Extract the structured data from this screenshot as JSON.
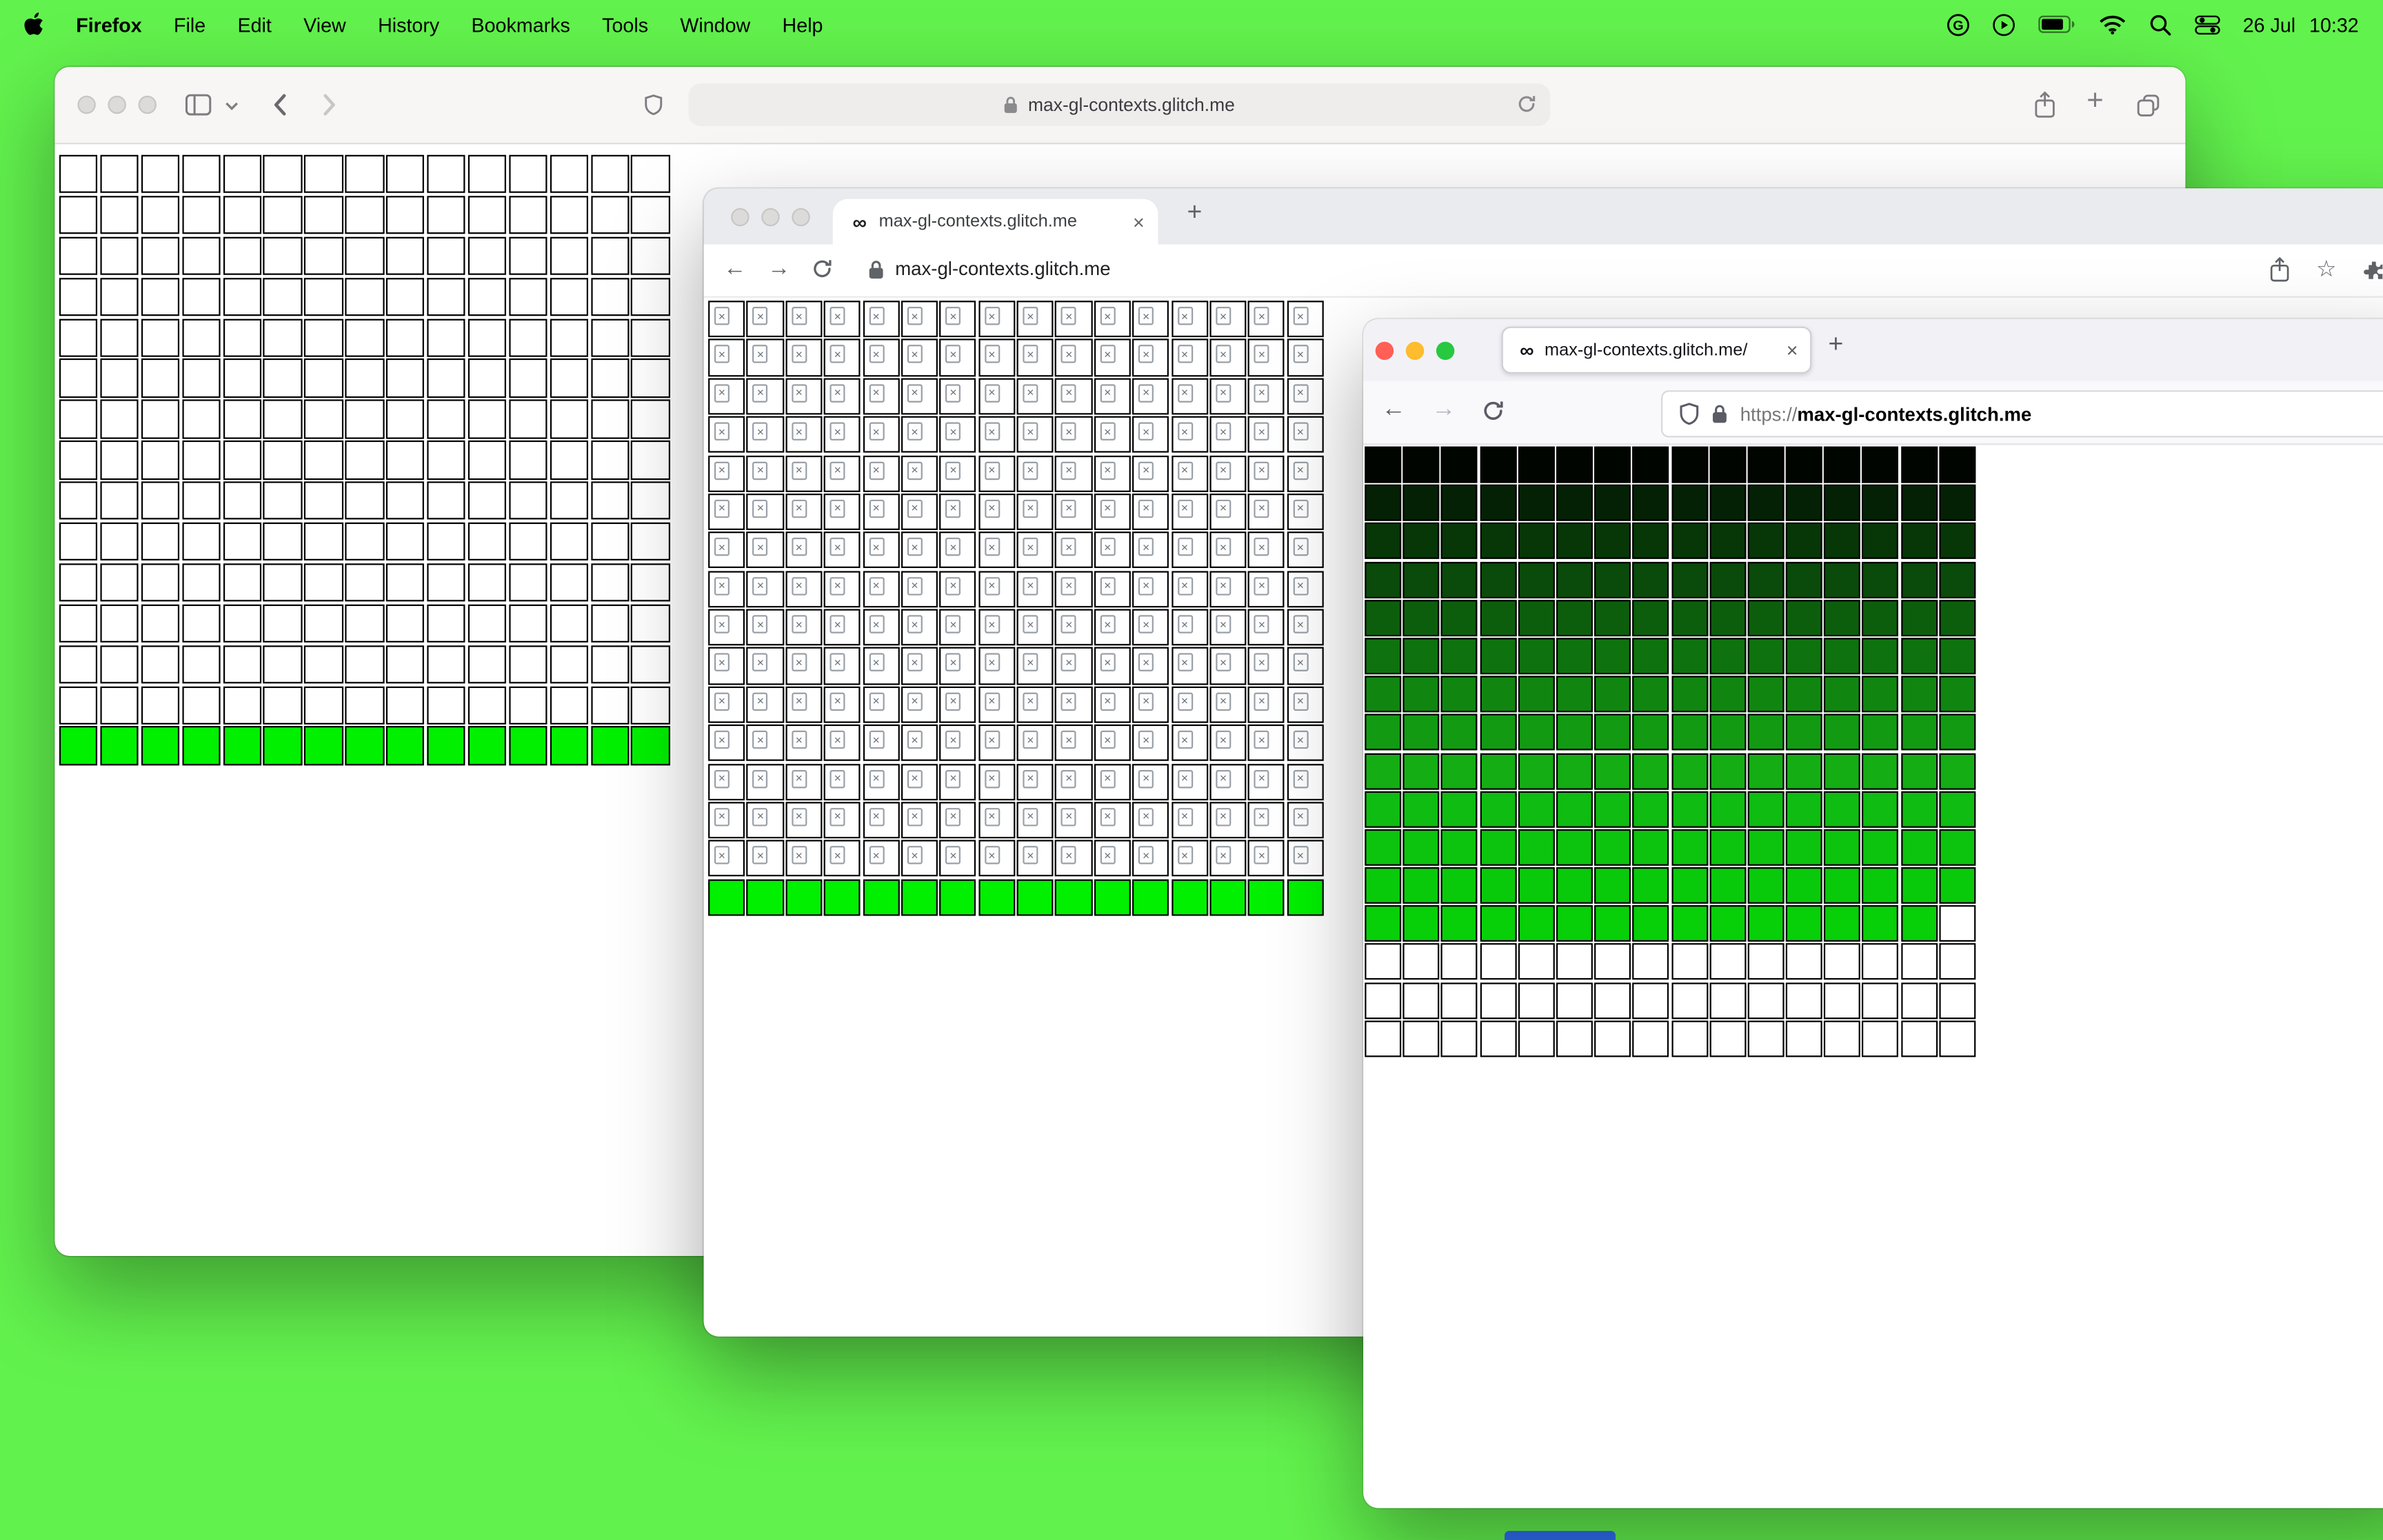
{
  "menubar": {
    "app_name": "Firefox",
    "items": [
      "File",
      "Edit",
      "View",
      "History",
      "Bookmarks",
      "Tools",
      "Window",
      "Help"
    ],
    "date": "26 Jul",
    "time": "10:32"
  },
  "icons": {
    "infinity": "∞",
    "close": "×",
    "plus": "+",
    "star": "☆"
  },
  "colors": {
    "desktop": "#62f24d",
    "lime": "#00f000",
    "dock_peek": "#2f6ef1"
  },
  "safari": {
    "url": "max-gl-contexts.glitch.me",
    "grid": {
      "cols": 15,
      "rows": 15,
      "cell": 25.3,
      "gap": 1.6,
      "last_row_green": true
    }
  },
  "chrome": {
    "tab_title": "max-gl-contexts.glitch.me",
    "url": "max-gl-contexts.glitch.me",
    "grid": {
      "cols": 16,
      "rows": 16,
      "cell": 24.2,
      "gap": 1.2,
      "last_row_green": true,
      "broken_icons": true
    }
  },
  "firefox": {
    "tab_title": "max-gl-contexts.glitch.me/",
    "url_protocol": "https://",
    "url_domain": "max-gl-contexts.glitch.me",
    "grid": {
      "cols": 16,
      "rows": 16,
      "cell": 24,
      "gap": 1.2,
      "row_colors": [
        "#000500",
        "#042105",
        "#073607",
        "#0a4a0a",
        "#0c5e0c",
        "#0e720e",
        "#108610",
        "#129a12",
        "#14ad14",
        "#0fbc11",
        "#0cc40d",
        "#09ca0a",
        "#07cf08"
      ],
      "white_tail_cells": 1
    }
  }
}
